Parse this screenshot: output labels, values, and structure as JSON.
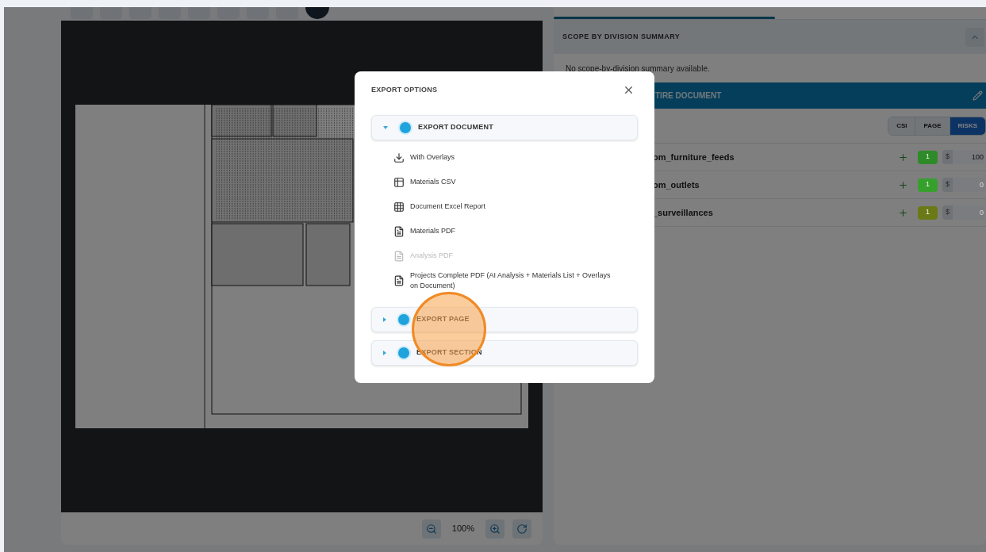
{
  "viewer": {
    "zoom": "100%"
  },
  "panel": {
    "summary_title": "SCOPE BY DIVISION SUMMARY",
    "summary_text": "No scope-by-division summary available.",
    "section_header": "TIRE DOCUMENT",
    "views": [
      {
        "label": "CSI",
        "selected": false
      },
      {
        "label": "PAGE",
        "selected": false
      },
      {
        "label": "RISKS",
        "selected": true
      }
    ],
    "rows": [
      {
        "name": "om_furniture_feeds",
        "count": "1",
        "color": "#2f8a28",
        "currency": "$",
        "value": "100"
      },
      {
        "name": "om_outlets",
        "count": "1",
        "color": "#36a02c",
        "currency": "$",
        "placeholder": "0"
      },
      {
        "name": "_surveillances",
        "count": "1",
        "color": "#6b7a16",
        "currency": "$",
        "placeholder": "0"
      }
    ]
  },
  "modal": {
    "title": "EXPORT OPTIONS",
    "sections": [
      {
        "label": "EXPORT DOCUMENT",
        "expanded": true,
        "items": [
          {
            "kind": "download",
            "label": "With Overlays",
            "disabled": false
          },
          {
            "kind": "table",
            "label": "Materials CSV",
            "disabled": false
          },
          {
            "kind": "grid",
            "label": "Document Excel Report",
            "disabled": false
          },
          {
            "kind": "pdf",
            "label": "Materials PDF",
            "disabled": false
          },
          {
            "kind": "pdf",
            "label": "Analysis PDF",
            "disabled": true
          },
          {
            "kind": "pdf",
            "label": "Projects Complete PDF (AI Analysis + Materials List + Overlays on Document)",
            "disabled": false
          }
        ]
      },
      {
        "label": "EXPORT PAGE",
        "expanded": false
      },
      {
        "label": "EXPORT SECTION",
        "expanded": false
      }
    ]
  }
}
